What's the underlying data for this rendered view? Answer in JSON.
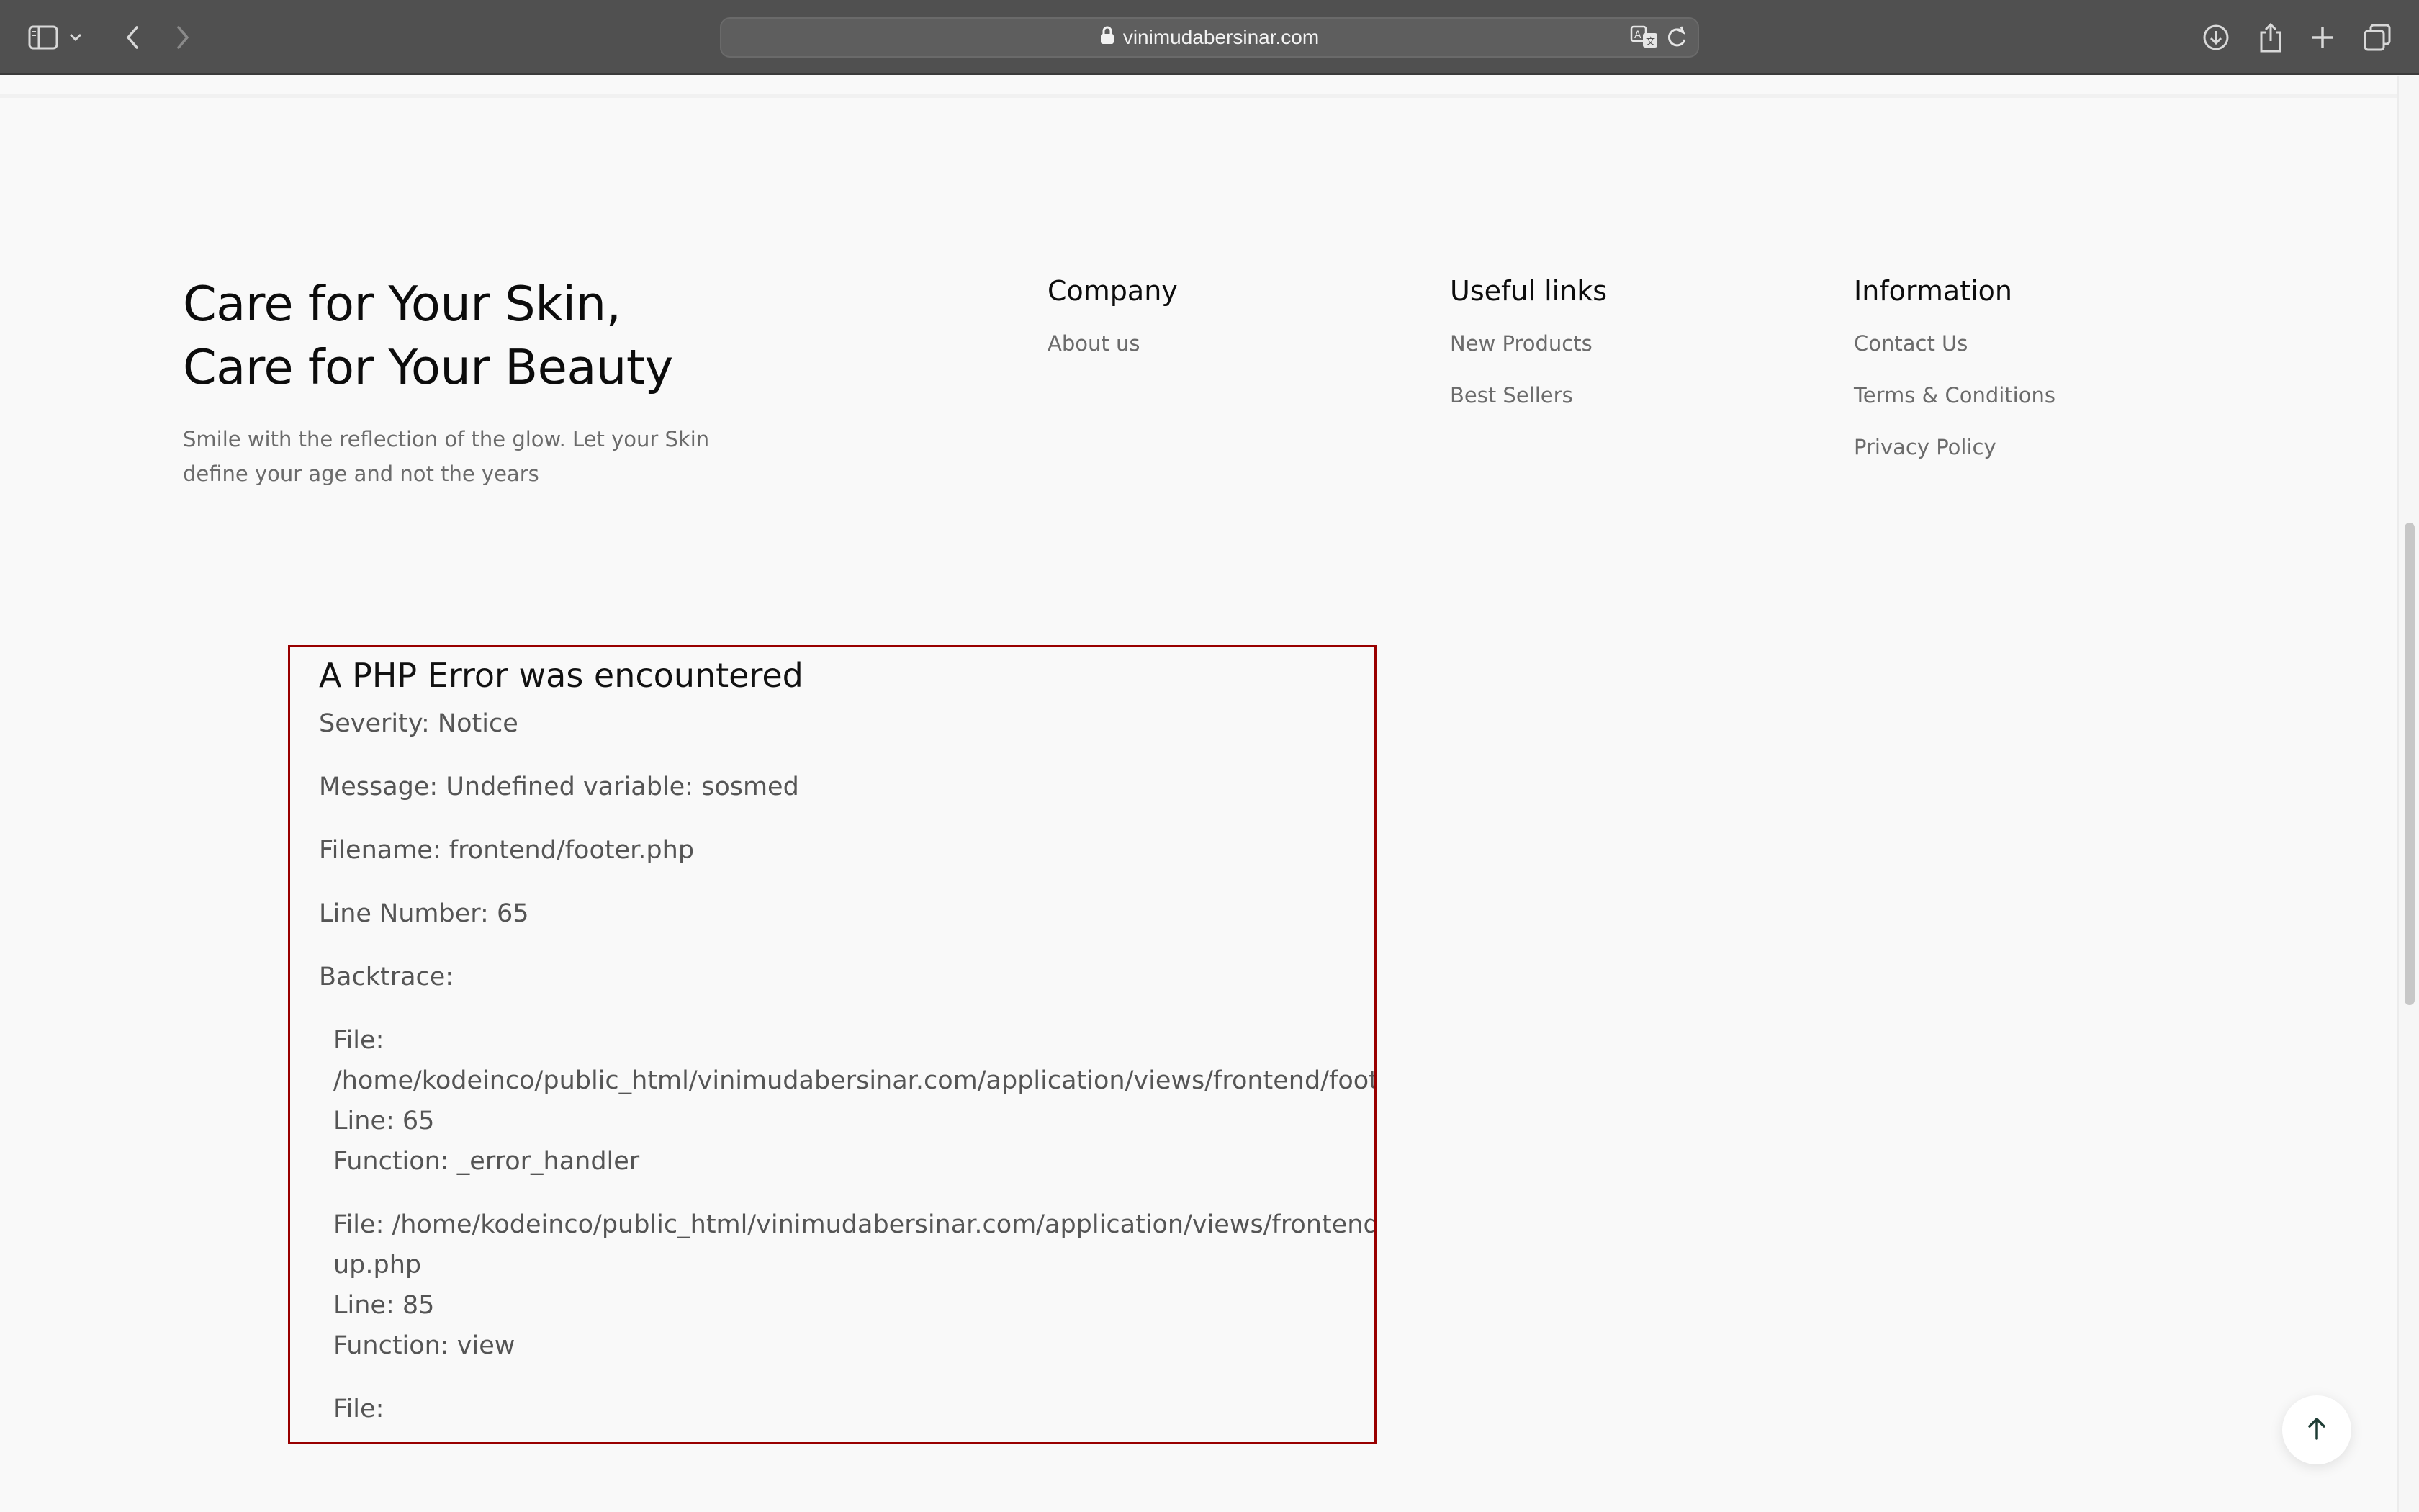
{
  "browser": {
    "url": "vinimudabersinar.com",
    "icons": {
      "sidebar": "sidebar-icon",
      "chevron": "chevron-down-icon",
      "back": "back-arrow-icon",
      "forward": "forward-arrow-icon",
      "lock": "lock-icon",
      "translate": "translate-icon",
      "reload": "reload-icon",
      "download": "download-icon",
      "share": "share-icon",
      "new_tab": "plus-icon",
      "tabs": "tabs-overview-icon"
    }
  },
  "footer": {
    "brand": {
      "title_line1": "Care for Your Skin,",
      "title_line2": "Care for Your Beauty",
      "description": "Smile with the reflection of the glow. Let your Skin define your age and not the years"
    },
    "columns": [
      {
        "heading": "Company",
        "links": [
          "About us"
        ]
      },
      {
        "heading": "Useful links",
        "links": [
          "New Products",
          "Best Sellers"
        ]
      },
      {
        "heading": "Information",
        "links": [
          "Contact Us",
          "Terms & Conditions",
          "Privacy Policy"
        ]
      }
    ]
  },
  "php_error": {
    "title": "A PHP Error was encountered",
    "severity": "Severity: Notice",
    "message": "Message: Undefined variable: sosmed",
    "filename": "Filename: frontend/footer.php",
    "line_number": "Line Number: 65",
    "backtrace_label": "Backtrace:",
    "traces": [
      {
        "file_label": "File:",
        "file_path": "/home/kodeinco/public_html/vinimudabersinar.com/application/views/frontend/footer.php",
        "line": "Line: 65",
        "function": "Function: _error_handler"
      },
      {
        "file_label": "File: /home/kodeinco/public_html/vinimudabersinar.com/application/views/frontend/sign-",
        "file_path": "up.php",
        "line": "Line: 85",
        "function": "Function: view"
      },
      {
        "file_label": "File:"
      }
    ]
  },
  "scroll_top": {
    "icon": "arrow-up-icon"
  },
  "colors": {
    "toolbar": "#505050",
    "page_bg": "#f9f9f9",
    "error_border": "#990000",
    "heading": "#0c0c0c",
    "muted_text": "#6b6b6b"
  }
}
